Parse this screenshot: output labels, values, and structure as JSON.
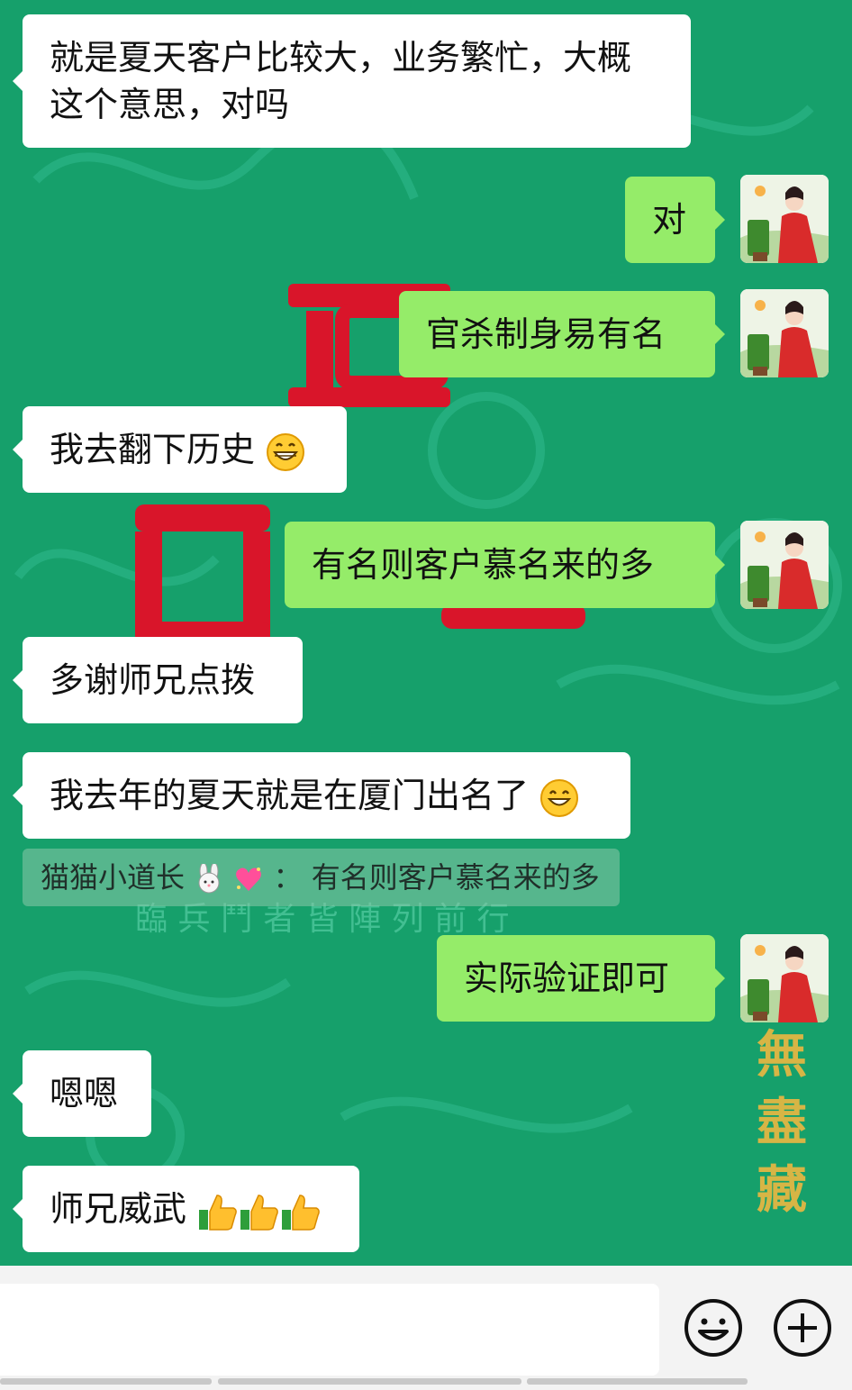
{
  "colors": {
    "chat_background": "#16a06b",
    "incoming_bubble": "#ffffff",
    "outgoing_bubble": "#95ec69",
    "input_bar": "#f3f3f3"
  },
  "messages": [
    {
      "direction": "in",
      "text": "就是夏天客户比较大，业务繁忙，大概这个意思，对吗"
    },
    {
      "direction": "out",
      "text": "对"
    },
    {
      "direction": "out",
      "text": "官杀制身易有名"
    },
    {
      "direction": "in",
      "text": "我去翻下历史",
      "emoji": "grinning-face-icon"
    },
    {
      "direction": "out",
      "text": "有名则客户慕名来的多"
    },
    {
      "direction": "in",
      "text": "多谢师兄点拨"
    },
    {
      "direction": "in",
      "text": "我去年的夏天就是在厦门出名了",
      "emoji": "smiling-face-icon"
    },
    {
      "direction": "out",
      "text": "实际验证即可"
    },
    {
      "direction": "in",
      "text": "嗯嗯"
    },
    {
      "direction": "in",
      "text": "师兄威武",
      "emoji": "thumbs-up-icon x3"
    }
  ],
  "quote": {
    "sender": "猫猫小道长",
    "sender_emojis": [
      "rabbit-face-icon",
      "sparkling-heart-icon"
    ],
    "separator": "：",
    "text": "有名则客户慕名来的多"
  },
  "background_text": {
    "row": "臨 兵 鬥 者 皆 陣 列 前 行",
    "vertical": "無 盡 藏"
  },
  "input": {
    "value": "",
    "placeholder": ""
  },
  "icons": {
    "emoji_button": "smiley-face-icon",
    "plus_button": "plus-circle-icon"
  }
}
